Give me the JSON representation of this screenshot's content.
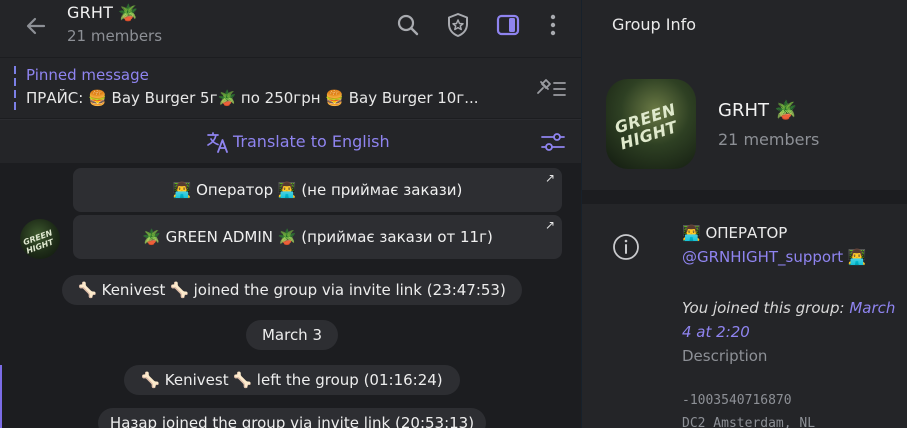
{
  "chat": {
    "title": "GRHT 🪴",
    "members": "21 members",
    "pinned": {
      "label": "Pinned message",
      "text": "ПРАЙС: 🍔 Bay Burger 5г🪴 по 250грн 🍔 Bay Burger 10г..."
    },
    "translate_label": "Translate to English",
    "bot_buttons": [
      {
        "label": "👨‍💻 Оператор 👨‍💻 (не приймає закази)"
      },
      {
        "label": "🪴 GREEN ADMIN 🪴 (приймає закази от 11г)"
      }
    ],
    "avatar_text": "GREEN HIGHT",
    "services": [
      {
        "text": "🦴 Kenivest 🦴 joined the group via invite link (23:47:53)"
      },
      {
        "text": "March 3"
      },
      {
        "text": "🦴 Kenivest 🦴 left the group (01:16:24)"
      },
      {
        "text": "Назар joined the group via invite link (20:53:13)"
      }
    ]
  },
  "info": {
    "panel_title": "Group Info",
    "avatar_text": "GREEN HIGHT",
    "name": "GRHT 🪴",
    "members": "21 members",
    "operator_line": "👨‍💻 ОПЕРАТОР",
    "operator_link": "@GRNHIGHT_support",
    "operator_link_emoji": "👨‍💻",
    "joined_prefix": "You joined this group: ",
    "joined_date": "March 4 at 2:20",
    "description_label": "Description",
    "group_id": "-1003540716870",
    "dc": "DC2 Amsterdam, NL"
  },
  "icons": [
    "back-arrow-icon",
    "search-icon",
    "shield-icon",
    "sidebar-toggle-icon",
    "more-vertical-icon",
    "pin-list-icon",
    "translate-icon",
    "settings-sliders-icon",
    "info-icon",
    "external-link-icon"
  ],
  "colors": {
    "accent": "#8f84f0",
    "panel": "#242528",
    "chat_bg": "#1c1d20",
    "bubble": "#2d2e32"
  }
}
